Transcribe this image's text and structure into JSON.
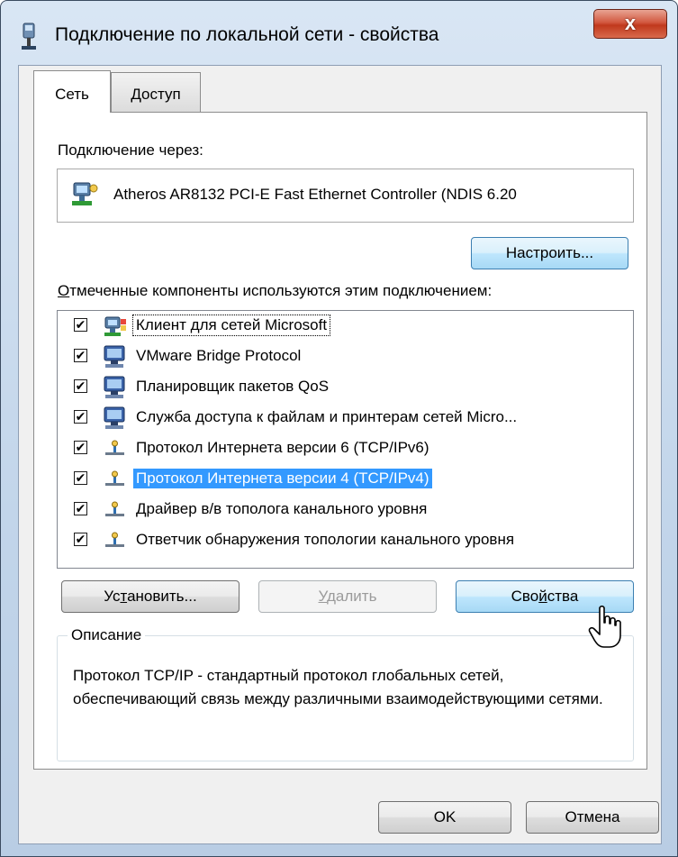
{
  "window": {
    "title": "Подключение по локальной сети - свойства",
    "close_symbol": "x",
    "title_icon": "network-connection-icon"
  },
  "tabs": [
    {
      "label": "Сеть",
      "active": true
    },
    {
      "label": "Доступ",
      "active": false
    }
  ],
  "connect_via": {
    "label": "Подключение через:",
    "adapter_name": "Atheros AR8132 PCI-E Fast Ethernet Controller (NDIS 6.20",
    "adapter_icon": "network-adapter-icon",
    "configure_button": "Настроить..."
  },
  "components": {
    "label_underlined": "О",
    "label_rest": "тмеченные компоненты используются этим подключением:",
    "items": [
      {
        "label": "Клиент для сетей Microsoft",
        "checked": true,
        "icon": "network-client-icon",
        "selected": false,
        "focused": true
      },
      {
        "label": "VMware Bridge Protocol",
        "checked": true,
        "icon": "service-icon",
        "selected": false,
        "focused": false
      },
      {
        "label": "Планировщик пакетов QoS",
        "checked": true,
        "icon": "service-icon",
        "selected": false,
        "focused": false
      },
      {
        "label": "Служба доступа к файлам и принтерам сетей Micro...",
        "checked": true,
        "icon": "service-icon",
        "selected": false,
        "focused": false
      },
      {
        "label": "Протокол Интернета версии 6 (TCP/IPv6)",
        "checked": true,
        "icon": "protocol-icon",
        "selected": false,
        "focused": false
      },
      {
        "label": "Протокол Интернета версии 4 (TCP/IPv4)",
        "checked": true,
        "icon": "protocol-icon",
        "selected": true,
        "focused": false
      },
      {
        "label": "Драйвер в/в тополога канального уровня",
        "checked": true,
        "icon": "protocol-icon",
        "selected": false,
        "focused": false
      },
      {
        "label": "Ответчик обнаружения топологии канального уровня",
        "checked": true,
        "icon": "protocol-icon",
        "selected": false,
        "focused": false
      }
    ],
    "check_mark": "✔"
  },
  "actions": {
    "install_pre": "Ус",
    "install_u": "т",
    "install_post": "ановить...",
    "remove_u": "У",
    "remove_post": "далить",
    "props_pre": "Сво",
    "props_u": "й",
    "props_post": "ства"
  },
  "description": {
    "legend": "Описание",
    "text": "Протокол TCP/IP - стандартный протокол глобальных сетей, обеспечивающий связь между различными взаимодействующими сетями."
  },
  "footer": {
    "ok": "OK",
    "cancel": "Отмена"
  },
  "colors": {
    "selection": "#3399ff",
    "close_button": "#c7432a",
    "window_frame": "#c2d5ea"
  }
}
